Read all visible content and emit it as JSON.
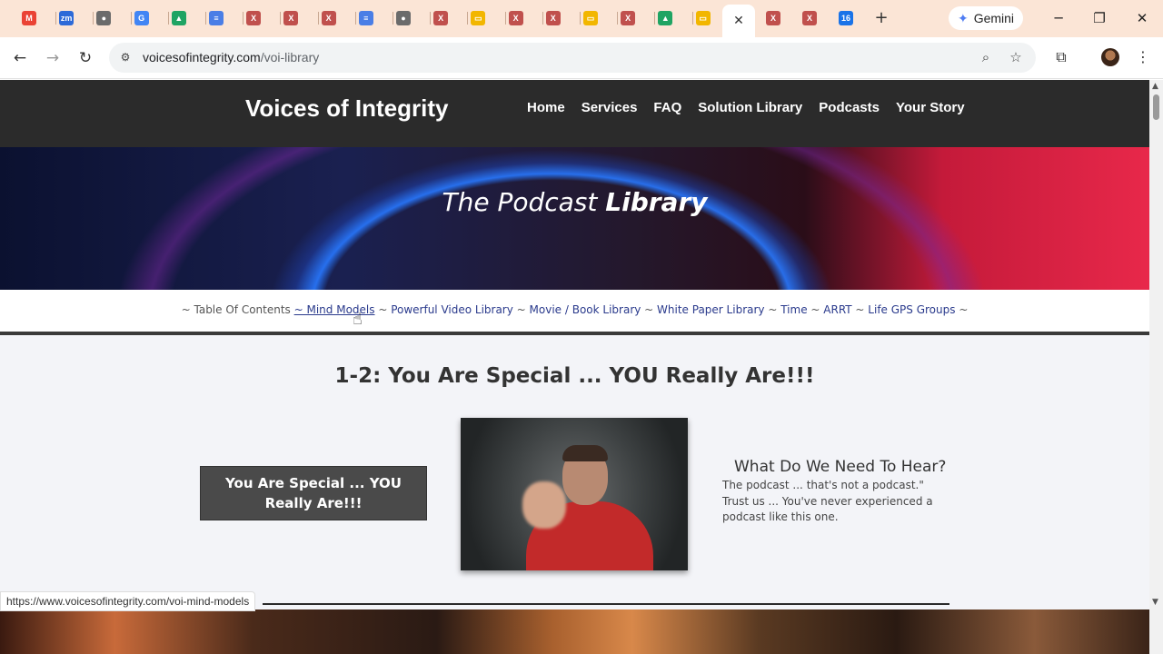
{
  "browser": {
    "tabs": [
      {
        "icon": "gmail-icon",
        "glyph": "M",
        "color": "#ea4335"
      },
      {
        "icon": "zoom-icon",
        "glyph": "zm",
        "color": "#2d6ad8"
      },
      {
        "icon": "globe-icon",
        "glyph": "●",
        "color": "#6b6b6b"
      },
      {
        "icon": "google-icon",
        "glyph": "G",
        "color": "#4285f4"
      },
      {
        "icon": "drive-icon",
        "glyph": "▲",
        "color": "#1fa463"
      },
      {
        "icon": "docs-icon",
        "glyph": "≡",
        "color": "#4a7ee6"
      },
      {
        "icon": "xmind-icon",
        "glyph": "X",
        "color": "#c0504d"
      },
      {
        "icon": "xmind-icon",
        "glyph": "X",
        "color": "#c0504d"
      },
      {
        "icon": "xmind-icon",
        "glyph": "X",
        "color": "#c0504d"
      },
      {
        "icon": "docs-icon",
        "glyph": "≡",
        "color": "#4a7ee6"
      },
      {
        "icon": "globe-icon",
        "glyph": "●",
        "color": "#6b6b6b"
      },
      {
        "icon": "xmind-icon",
        "glyph": "X",
        "color": "#c0504d"
      },
      {
        "icon": "slides-icon",
        "glyph": "▭",
        "color": "#f2b600"
      },
      {
        "icon": "xmind-icon",
        "glyph": "X",
        "color": "#c0504d"
      },
      {
        "icon": "xmind-icon",
        "glyph": "X",
        "color": "#c0504d"
      },
      {
        "icon": "slides-icon",
        "glyph": "▭",
        "color": "#f2b600"
      },
      {
        "icon": "xmind-icon",
        "glyph": "X",
        "color": "#c0504d"
      },
      {
        "icon": "drive-icon",
        "glyph": "▲",
        "color": "#1fa463"
      },
      {
        "icon": "slides-icon",
        "glyph": "▭",
        "color": "#f2b600"
      }
    ],
    "tabs_right": [
      {
        "icon": "xmind-icon",
        "glyph": "X",
        "color": "#c0504d"
      },
      {
        "icon": "xmind-icon",
        "glyph": "X",
        "color": "#c0504d"
      },
      {
        "icon": "calendar-icon",
        "glyph": "16",
        "color": "#1a73e8"
      }
    ],
    "active_tab_close": "✕",
    "new_tab": "+",
    "gemini_label": "Gemini",
    "url_host": "voicesofintegrity.com",
    "url_path": "/voi-library",
    "status_url": "https://www.voicesofintegrity.com/voi-mind-models"
  },
  "site": {
    "logo": "Voices of Integrity",
    "nav": [
      "Home",
      "Services",
      "FAQ",
      "Solution Library",
      "Podcasts",
      "Your Story"
    ]
  },
  "hero": {
    "title_italic": "The Podcast ",
    "title_bold": "Library"
  },
  "toc": {
    "prefix": "~ Table Of Contents ",
    "links": [
      "~ Mind Models",
      "Powerful Video Library",
      "Movie / Book Library",
      "White Paper Library",
      "Time",
      "ARRT",
      "Life GPS Groups"
    ],
    "separator": " ~ ",
    "suffix": " ~"
  },
  "episode": {
    "section_title": "1-2: You Are Special ... YOU Really Are!!!",
    "button_label": "You Are Special ... YOU Really Are!!!",
    "side_title": "What Do We Need To Hear?",
    "side_text": "The podcast ... that's not a podcast.\" Trust us ... You've never experienced a podcast like this one."
  }
}
